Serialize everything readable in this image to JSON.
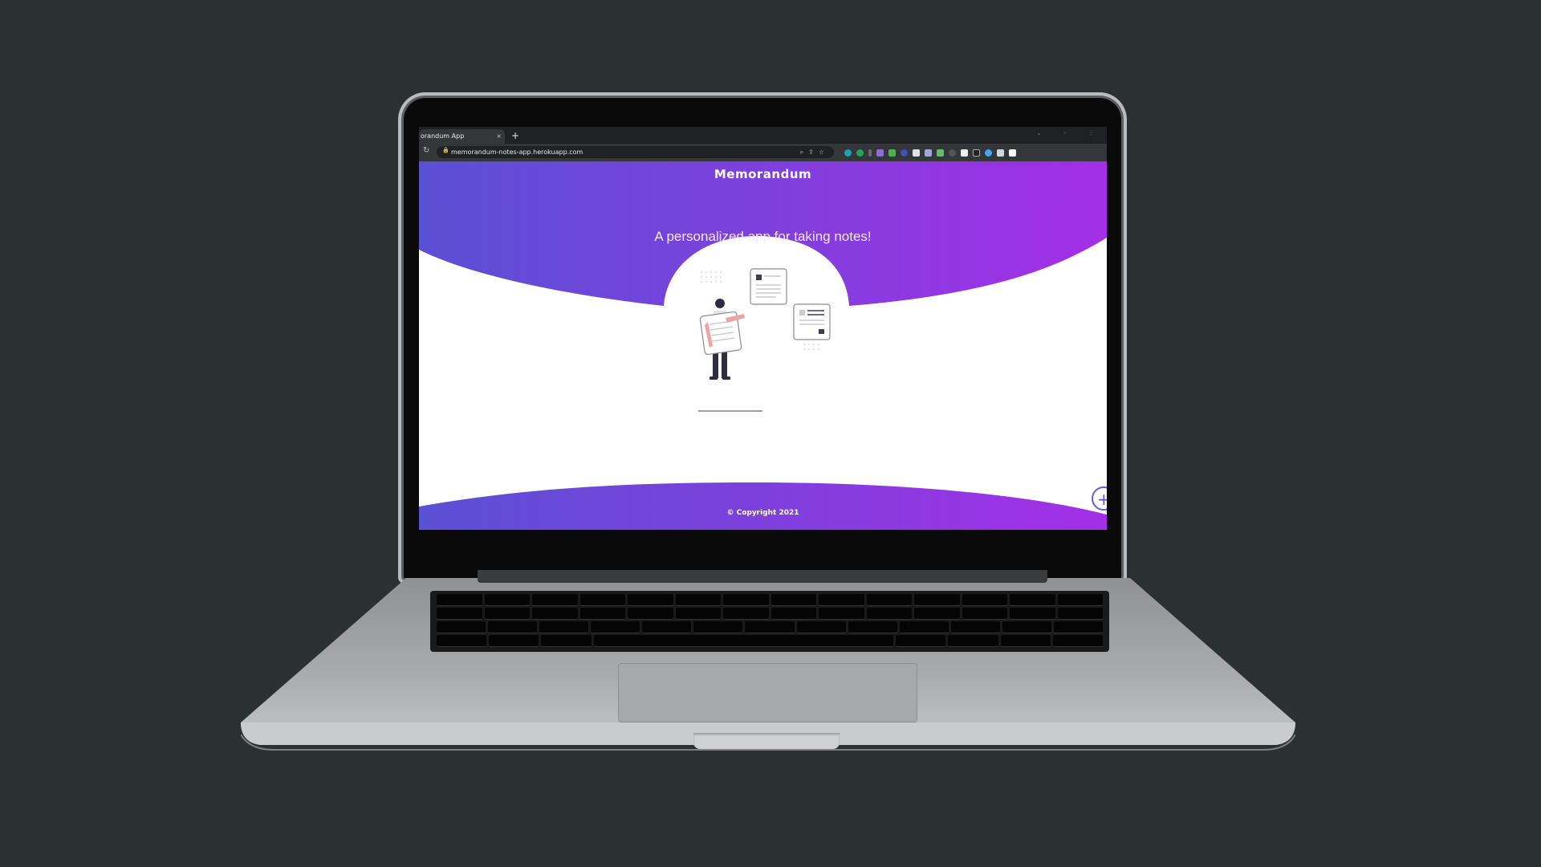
{
  "browser": {
    "tab_title": "orandum App",
    "tab_close": "×",
    "new_tab": "+",
    "url": "memorandum-notes-app.herokuapp.com"
  },
  "page": {
    "brand": "Memorandum",
    "tagline": "A personalized app for taking notes!",
    "copyright": "© Copyright 2021",
    "fab_label": "+"
  },
  "colors": {
    "background": "#2b3130",
    "gradient_start": "#5a50d4",
    "gradient_end": "#a32fe6",
    "illustration_accent": "#f0a3a7"
  },
  "icons": [
    "reload-icon",
    "lock-icon",
    "zoom-icon",
    "share-icon",
    "bookmark-star-icon",
    "extensions-icon",
    "sidepanel-icon",
    "add-note-icon"
  ]
}
